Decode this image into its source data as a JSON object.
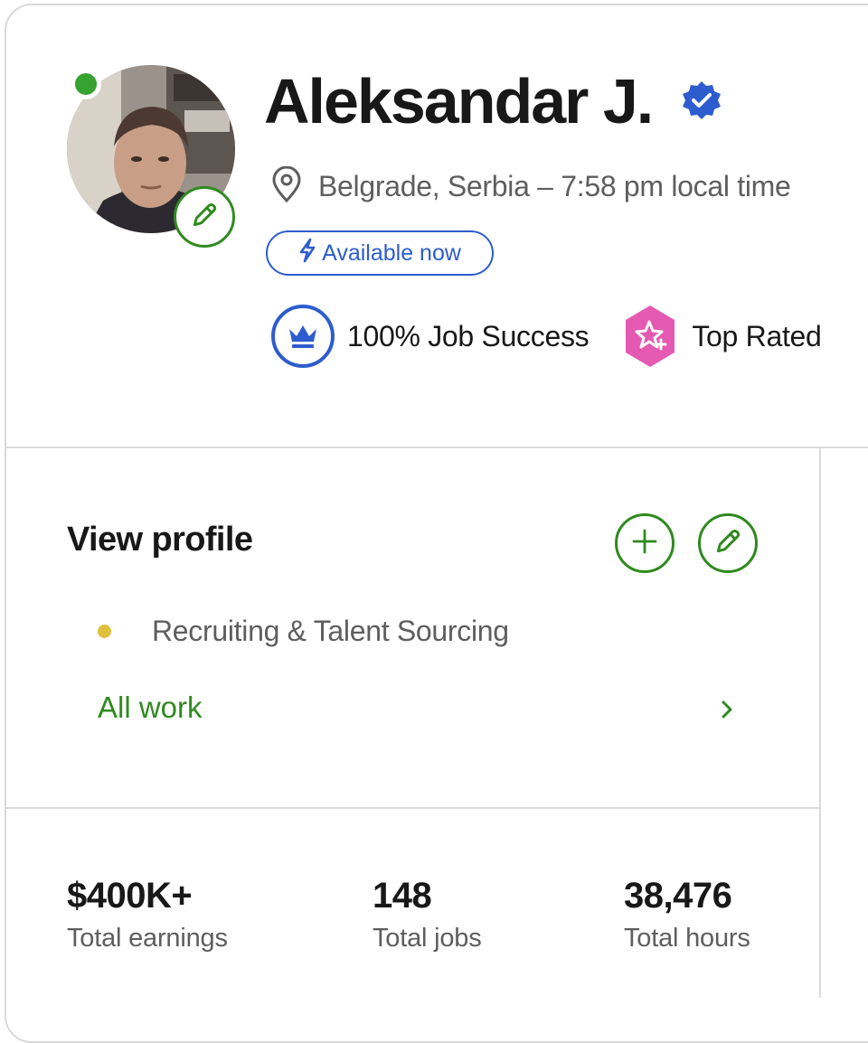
{
  "profile": {
    "name": "Aleksandar J.",
    "location": "Belgrade, Serbia – 7:58 pm local time",
    "availability": "Available now",
    "badges": {
      "job_success": "100% Job Success",
      "top_rated": "Top Rated"
    }
  },
  "section": {
    "title": "View profile",
    "specialty": "Recruiting & Talent Sourcing",
    "all_work_link": "All work"
  },
  "stats": [
    {
      "value": "$400K+",
      "label": "Total earnings"
    },
    {
      "value": "148",
      "label": "Total jobs"
    },
    {
      "value": "38,476",
      "label": "Total hours"
    }
  ],
  "colors": {
    "accent_green": "#2f8a1e",
    "online_green": "#36a22f",
    "brand_blue": "#2d5cce",
    "top_rated_pink": "#e45ab2",
    "specialty_dot": "#e0bf3c"
  },
  "icons": [
    "avatar",
    "online-status-indicator",
    "pencil-icon",
    "verified-badge-icon",
    "location-pin-icon",
    "lightning-icon",
    "crown-icon",
    "star-badge-icon",
    "plus-icon",
    "chevron-right-icon"
  ]
}
